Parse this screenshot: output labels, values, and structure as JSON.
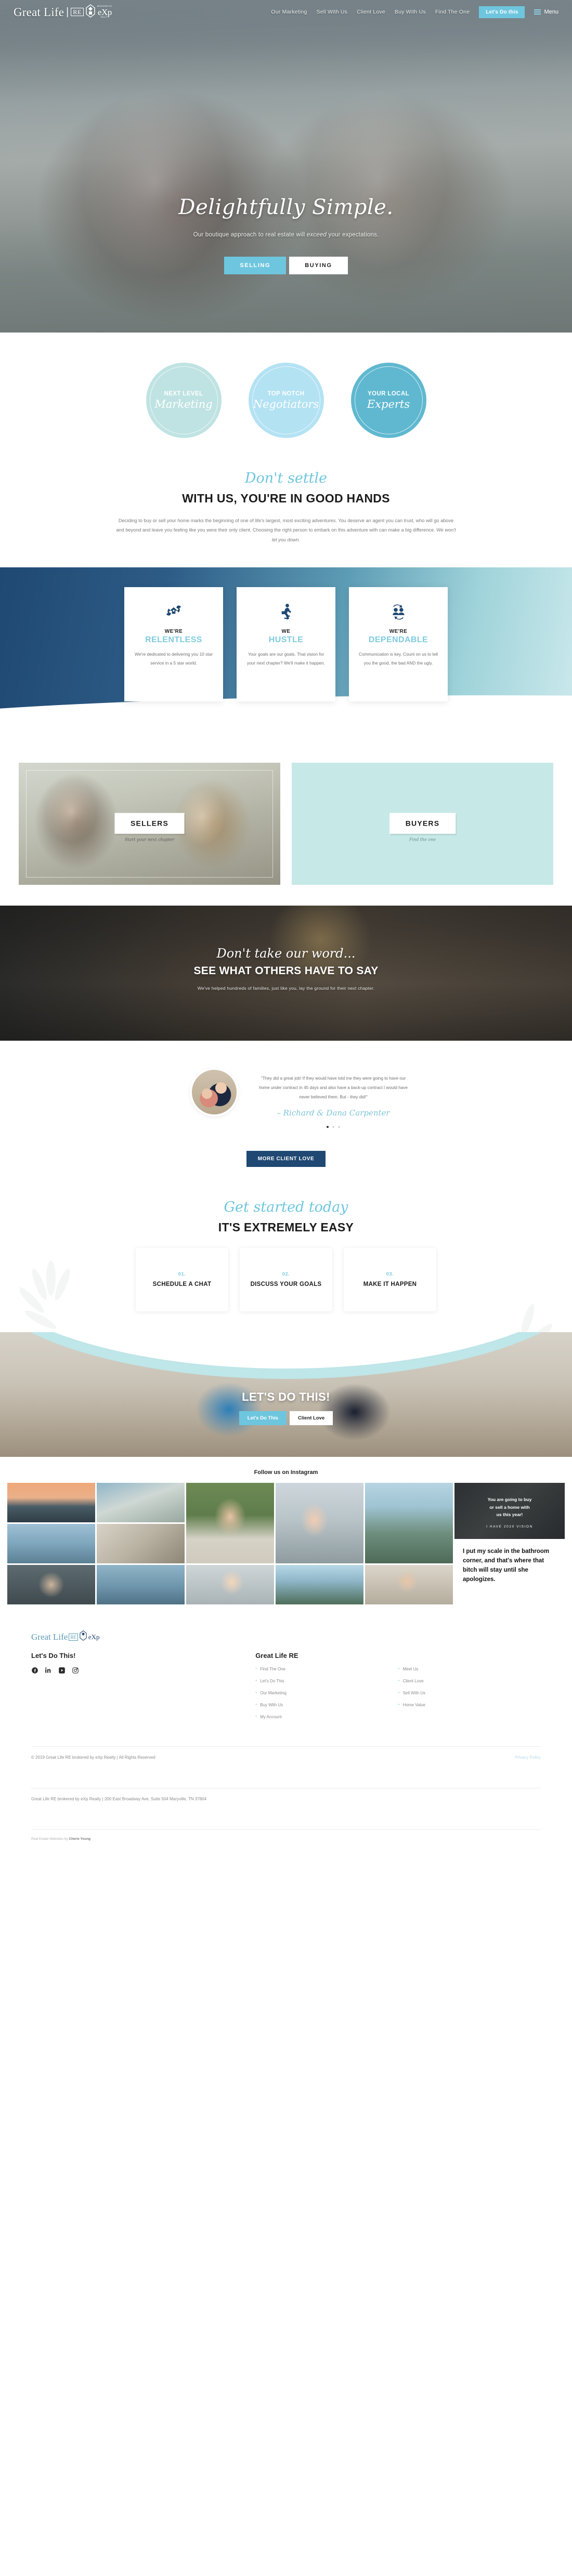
{
  "header": {
    "brand": {
      "name": "Great Life",
      "re": "RE",
      "exp_top": "BROKERED BY",
      "exp": "eXp",
      "exp_bottom": "REALTY"
    },
    "nav": [
      "Our Marketing",
      "Sell With Us",
      "Client Love",
      "Buy With Us",
      "Find The One"
    ],
    "cta_label": "Let's Do this",
    "menu_label": "Menu"
  },
  "hero": {
    "script": "Delightfully Simple.",
    "subtitle_pre": "Our boutique approach to real estate will ",
    "subtitle_em": "exceed",
    "subtitle_post": " your expectations.",
    "btn_selling": "SELLING",
    "btn_buying": "BUYING"
  },
  "circles": [
    {
      "top": "NEXT LEVEL",
      "script": "Marketing",
      "color": "#bfe3e2"
    },
    {
      "top": "TOP NOTCH",
      "script": "Negotiators",
      "color": "#b3e2f3"
    },
    {
      "top": "YOUR LOCAL",
      "script": "Experts",
      "color": "#5fb8d0"
    }
  ],
  "settle": {
    "script": "Don't settle",
    "heading": "WITH US, YOU'RE IN GOOD HANDS",
    "body": "Deciding to buy or sell your home marks the beginning of one of life's largest, most exciting adventures. You deserve an agent you can trust, who will go above and beyond and leave you feeling like you were their only client. Choosing the right person to embark on this adventure with can make a big difference. ",
    "body_em": "We won't let you down."
  },
  "cards": [
    {
      "icon": "hands-house-icon",
      "l1": "WE'RE",
      "l2": "RELENTLESS",
      "desc": "We're dedicated to delivering you 10 star service in a 5 star world."
    },
    {
      "icon": "running-person-icon",
      "l1": "WE",
      "l2": "HUSTLE",
      "desc": "Your goals are our goals. That vision for your next chapter? We'll make it happen."
    },
    {
      "icon": "people-cycle-icon",
      "l1": "WE'RE",
      "l2": "DEPENDABLE",
      "desc": "Communication is key. Count on us to tell you the good, the bad AND the ugly."
    }
  ],
  "sellers_buyers": {
    "sellers_label": "SELLERS",
    "sellers_caption": "Start your next chapter",
    "buyers_label": "BUYERS",
    "buyers_caption": "Find the one"
  },
  "testimonial_header": {
    "script": "Don't take our word...",
    "heading": "SEE WHAT OTHERS HAVE TO SAY",
    "sub": "We've helped hundreds of families, just like you, lay the ground for their next chapter."
  },
  "testimonial": {
    "quote": "\"They did a great job! If they would have told me they were going to have our home under contract in 45 days and also have a back-up contract I would have never believed them. But - they did!\"",
    "author": "– Richard & Dana Carpenter",
    "more_button": "MORE CLIENT LOVE",
    "dots": 3,
    "active_dot": 0
  },
  "started": {
    "script": "Get started today",
    "heading": "IT'S EXTREMELY EASY",
    "steps": [
      {
        "num": "01.",
        "title": "SCHEDULE A CHAT"
      },
      {
        "num": "02.",
        "title": "DISCUSS YOUR GOALS"
      },
      {
        "num": "03.",
        "title": "MAKE IT HAPPEN"
      }
    ]
  },
  "lets": {
    "heading": "LET'S DO THIS!",
    "btn_primary": "Let's Do This",
    "btn_secondary": "Client Love"
  },
  "instagram": {
    "heading": "Follow us on Instagram",
    "quote_card": {
      "line1": "You are going to buy",
      "line2": "or sell a home with",
      "line3": "us this year!",
      "vision": "I HAVE 2020 VISION",
      "body": "I put my scale in the bathroom corner, and that's where that bitch will stay until she apologizes."
    }
  },
  "footer": {
    "brand": {
      "name": "Great Life",
      "re": "RE",
      "exp": "eXp"
    },
    "col1_heading": "Let's Do This!",
    "socials": [
      "facebook-icon",
      "linkedin-icon",
      "youtube-icon",
      "instagram-icon"
    ],
    "col2_heading": "Great Life RE",
    "links_a": [
      "Find The One",
      "Let's Do This",
      "Our Marketing",
      "Buy With Us",
      "My Account"
    ],
    "links_b": [
      "Meet Us",
      "Client Love",
      "Sell With Us",
      "Home Value"
    ],
    "copyright": "© 2019 Great Life RE brokered by eXp Realty | All Rights Reserved",
    "privacy": "Privacy Policy",
    "address": "Great Life RE brokered by eXp Realty | 200 East Broadway Ave, Suite 504 Maryville, TN 37804",
    "credit_pre": "Real Estate Websites by ",
    "credit_name": "Cherie Young"
  },
  "colors": {
    "accent": "#6ec6de",
    "navy": "#1f4872",
    "mint": "#c6e9e8",
    "light_blue": "#7fcbe0"
  }
}
